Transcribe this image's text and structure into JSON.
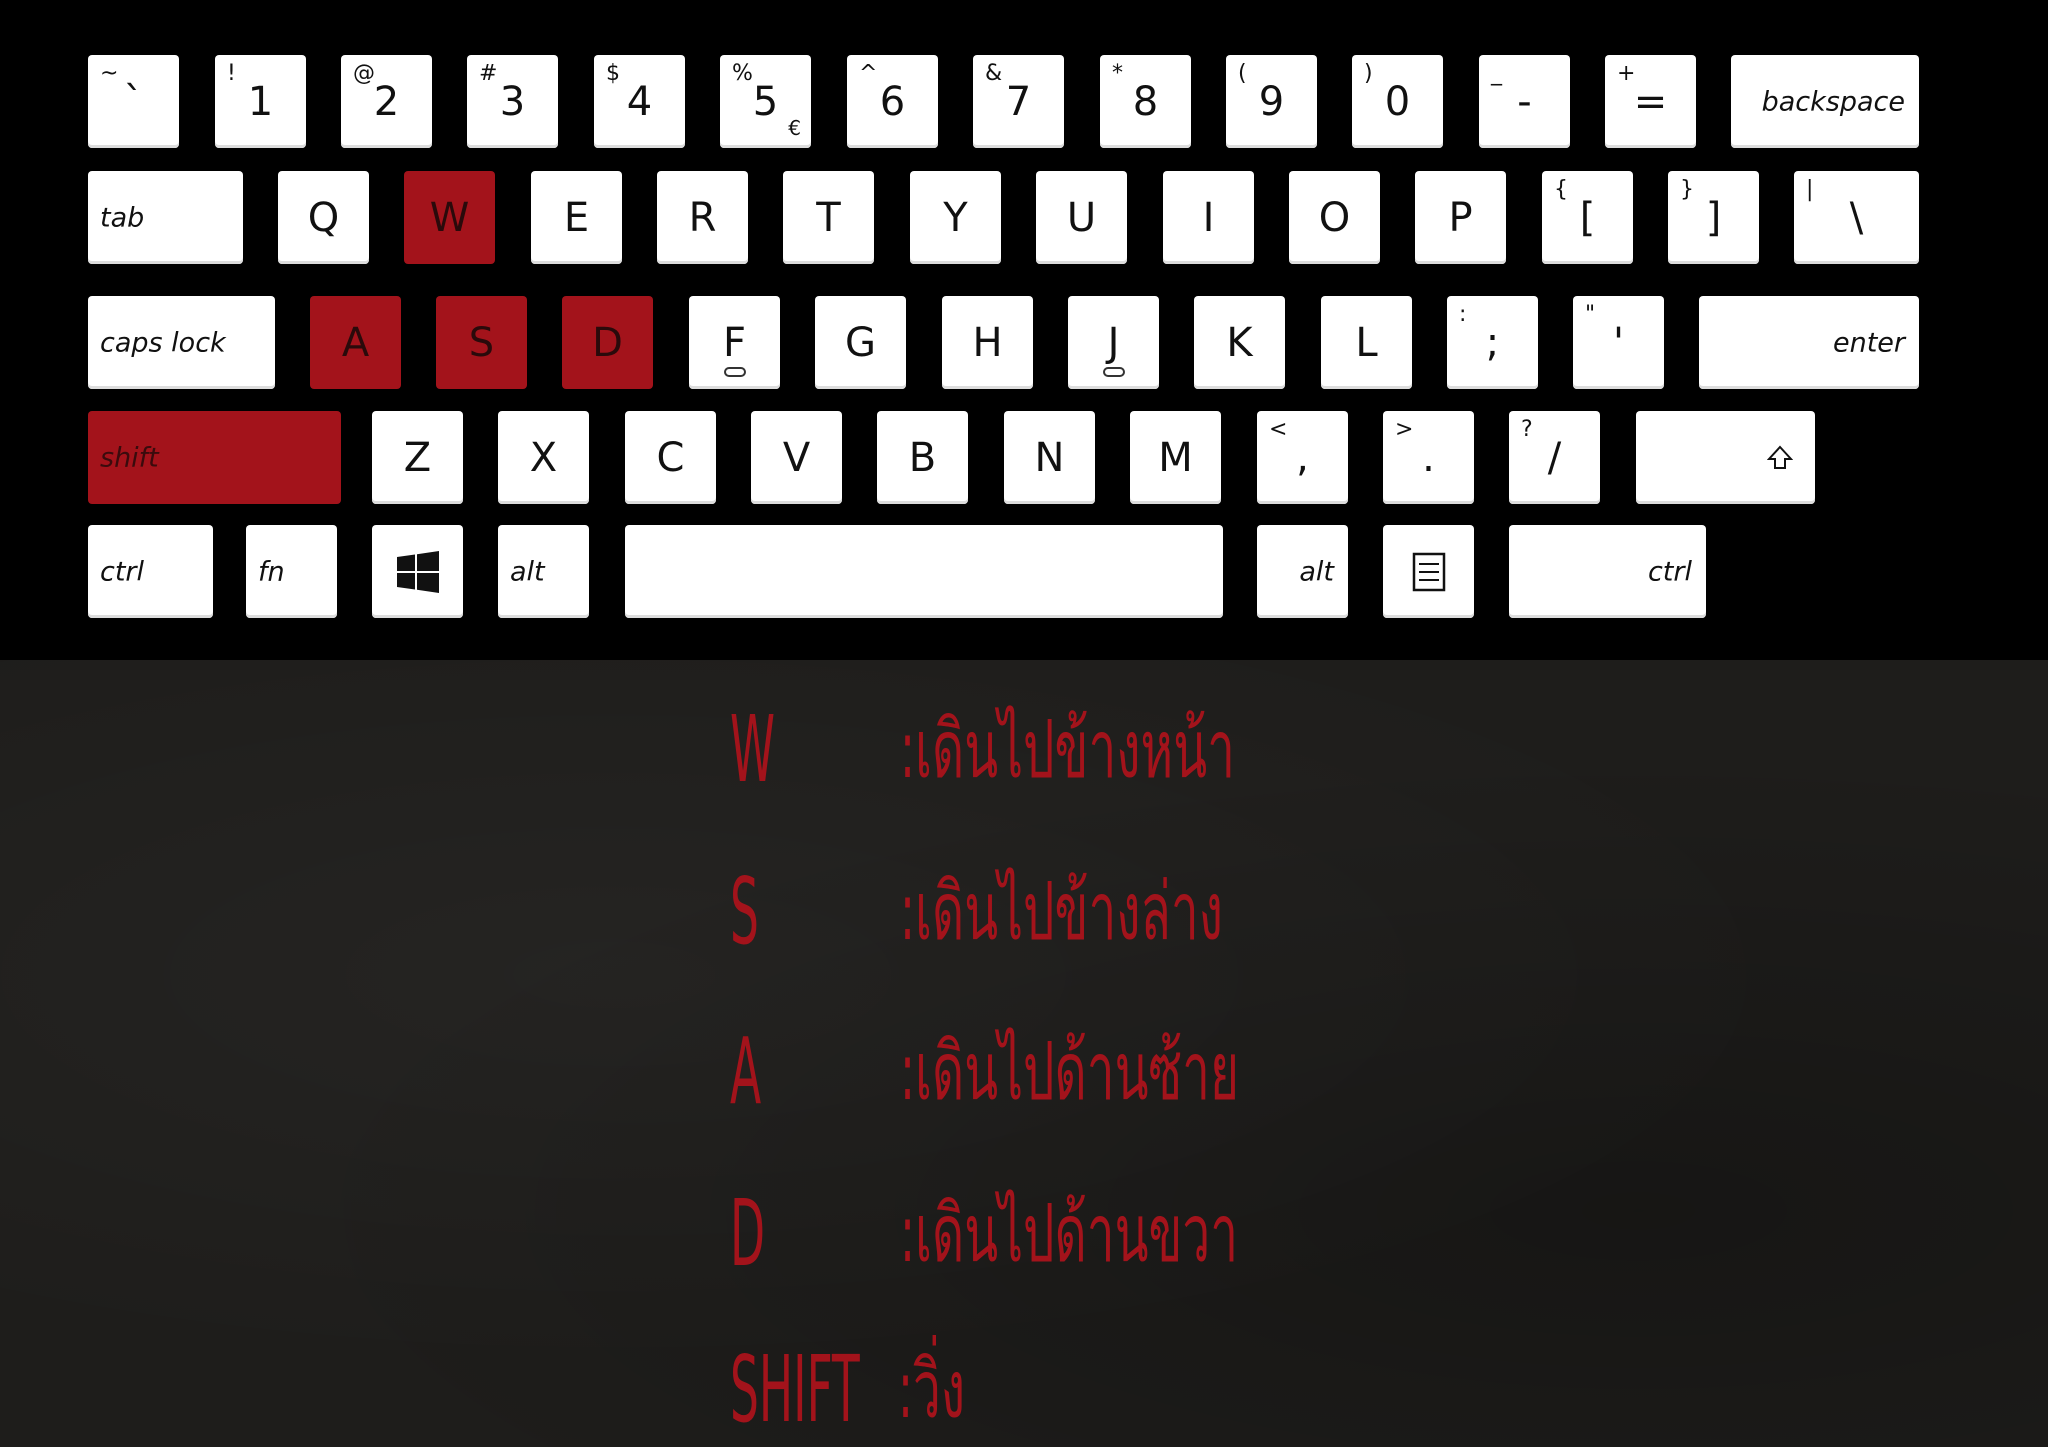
{
  "keyboard": {
    "accent_color": "#a3131b",
    "row1": [
      {
        "top": "~",
        "main": "`"
      },
      {
        "top": "!",
        "main": "1"
      },
      {
        "top": "@",
        "main": "2"
      },
      {
        "top": "#",
        "main": "3"
      },
      {
        "top": "$",
        "main": "4"
      },
      {
        "top": "%",
        "main": "5",
        "sub": "€"
      },
      {
        "top": "^",
        "main": "6"
      },
      {
        "top": "&",
        "main": "7"
      },
      {
        "top": "*",
        "main": "8"
      },
      {
        "top": "(",
        "main": "9"
      },
      {
        "top": ")",
        "main": "0"
      },
      {
        "top": "_",
        "main": "-"
      },
      {
        "top": "+",
        "main": "="
      },
      {
        "word": "backspace"
      }
    ],
    "row2": [
      {
        "word": "tab"
      },
      {
        "main": "Q"
      },
      {
        "main": "W",
        "highlighted": true
      },
      {
        "main": "E"
      },
      {
        "main": "R"
      },
      {
        "main": "T"
      },
      {
        "main": "Y"
      },
      {
        "main": "U"
      },
      {
        "main": "I"
      },
      {
        "main": "O"
      },
      {
        "main": "P"
      },
      {
        "top": "{",
        "main": "["
      },
      {
        "top": "}",
        "main": "]"
      },
      {
        "top": "|",
        "main": "\\"
      }
    ],
    "row3": [
      {
        "word": "caps lock"
      },
      {
        "main": "A",
        "highlighted": true
      },
      {
        "main": "S",
        "highlighted": true
      },
      {
        "main": "D",
        "highlighted": true
      },
      {
        "main": "F"
      },
      {
        "main": "G"
      },
      {
        "main": "H"
      },
      {
        "main": "J"
      },
      {
        "main": "K"
      },
      {
        "main": "L"
      },
      {
        "top": ":",
        "main": ";"
      },
      {
        "top": "\"",
        "main": "'"
      },
      {
        "word": "enter"
      }
    ],
    "row4": [
      {
        "word": "shift",
        "highlighted": true
      },
      {
        "main": "Z"
      },
      {
        "main": "X"
      },
      {
        "main": "C"
      },
      {
        "main": "V"
      },
      {
        "main": "B"
      },
      {
        "main": "N"
      },
      {
        "main": "M"
      },
      {
        "top": "<",
        "main": ","
      },
      {
        "top": ">",
        "main": "."
      },
      {
        "top": "?",
        "main": "/"
      },
      {
        "icon": "shift-arrow-icon"
      }
    ],
    "row5": [
      {
        "word": "ctrl"
      },
      {
        "word": "fn"
      },
      {
        "icon": "windows-logo-icon"
      },
      {
        "word": "alt"
      },
      {
        "icon": "spacebar"
      },
      {
        "word": "alt"
      },
      {
        "icon": "menu-icon"
      },
      {
        "word": "ctrl"
      }
    ]
  },
  "controls": [
    {
      "key": "W",
      "desc": ":เดินไปข้างหน้า"
    },
    {
      "key": "S",
      "desc": ":เดินไปข้างล่าง"
    },
    {
      "key": "A",
      "desc": ":เดินไปด้านซ้าย"
    },
    {
      "key": "D",
      "desc": ":เดินไปด้านขวา"
    },
    {
      "key": "SHIFT",
      "desc": ":วิ่ง"
    }
  ]
}
